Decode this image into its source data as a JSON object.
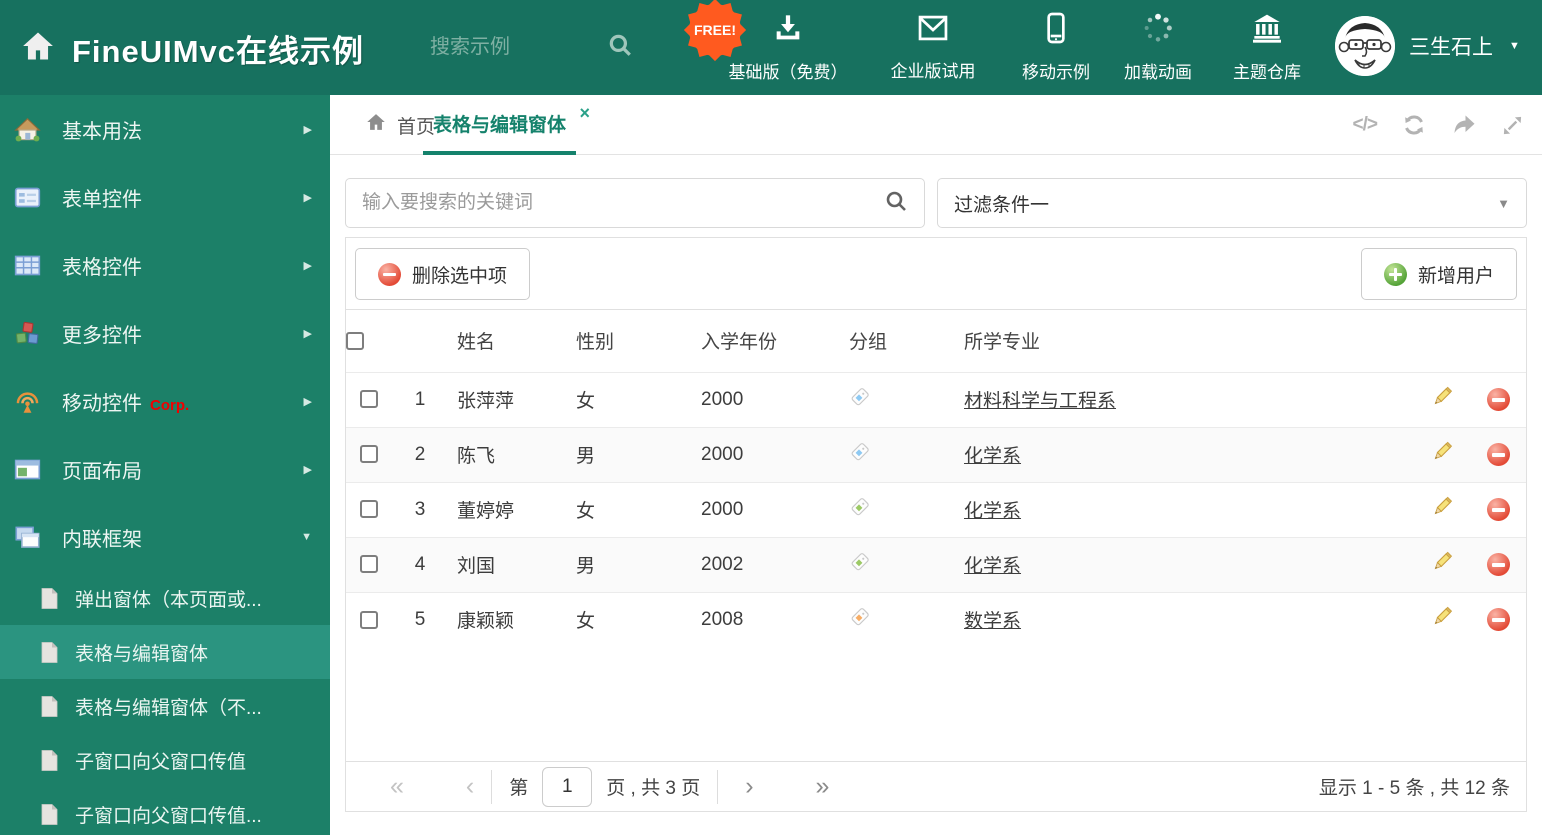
{
  "header": {
    "brand": "FineUIMvc在线示例",
    "search_placeholder": "搜索示例",
    "free_badge": "FREE!",
    "nav_items": [
      {
        "label": "基础版（免费）",
        "icon": "download-icon"
      },
      {
        "label": "企业版试用",
        "icon": "envelope-icon"
      },
      {
        "label": "移动示例",
        "icon": "mobile-icon"
      },
      {
        "label": "加载动画",
        "icon": "spinner-icon"
      },
      {
        "label": "主题仓库",
        "icon": "bank-icon"
      }
    ],
    "user": {
      "name": "三生石上"
    }
  },
  "sidebar": {
    "items": [
      {
        "label": "基本用法",
        "icon": "home-colored-icon",
        "expanded": false
      },
      {
        "label": "表单控件",
        "icon": "form-icon",
        "expanded": false
      },
      {
        "label": "表格控件",
        "icon": "table-icon",
        "expanded": false
      },
      {
        "label": "更多控件",
        "icon": "cubes-icon",
        "expanded": false
      },
      {
        "label": "移动控件",
        "badge": "Corp.",
        "icon": "antenna-icon",
        "expanded": false
      },
      {
        "label": "页面布局",
        "icon": "layout-icon",
        "expanded": false
      },
      {
        "label": "内联框架",
        "icon": "frames-icon",
        "expanded": true
      }
    ],
    "subitems": [
      {
        "label": "弹出窗体（本页面或...",
        "active": false
      },
      {
        "label": "表格与编辑窗体",
        "active": true
      },
      {
        "label": "表格与编辑窗体（不...",
        "active": false
      },
      {
        "label": "子窗口向父窗口传值",
        "active": false
      },
      {
        "label": "子窗口向父窗口传值...",
        "active": false
      }
    ]
  },
  "tabs": [
    {
      "label": "首页",
      "active": false
    },
    {
      "label": "表格与编辑窗体",
      "active": true,
      "closable": true
    }
  ],
  "filters": {
    "search_placeholder": "输入要搜索的关键词",
    "filter_value": "过滤条件一"
  },
  "toolbar": {
    "delete_label": "删除选中项",
    "add_label": "新增用户"
  },
  "table": {
    "columns": [
      "姓名",
      "性别",
      "入学年份",
      "分组",
      "所学专业"
    ],
    "rows": [
      {
        "num": "1",
        "name": "张萍萍",
        "gender": "女",
        "year": "2000",
        "tag_color": "#8ec9f2",
        "major": "材料科学与工程系"
      },
      {
        "num": "2",
        "name": "陈飞",
        "gender": "男",
        "year": "2000",
        "tag_color": "#8ec9f2",
        "major": "化学系"
      },
      {
        "num": "3",
        "name": "董婷婷",
        "gender": "女",
        "year": "2000",
        "tag_color": "#9cc965",
        "major": "化学系"
      },
      {
        "num": "4",
        "name": "刘国",
        "gender": "男",
        "year": "2002",
        "tag_color": "#9cc965",
        "major": "化学系"
      },
      {
        "num": "5",
        "name": "康颖颖",
        "gender": "女",
        "year": "2008",
        "tag_color": "#f6ad66",
        "major": "数学系"
      }
    ]
  },
  "pagination": {
    "prefix": "第",
    "page": "1",
    "suffix": "页 , 共 3 页",
    "summary": "显示 1 - 5 条 , 共 12 条"
  },
  "icons": {
    "caret_right": "▶",
    "caret_down": "▼",
    "user_caret": "▼",
    "filter_caret": "▼",
    "close": "×",
    "code": "</>",
    "first": "«",
    "prev": "‹",
    "next": "›",
    "last": "»"
  },
  "colors": {
    "header_bg": "#17715f",
    "sidebar_bg": "#1c8068",
    "sidebar_active_bg": "#2b9480",
    "accent_teal": "#15826c",
    "free_badge_bg": "#ff5a1f",
    "corp_badge": "#f10000",
    "delete_red": "#e34a36",
    "add_green": "#55a338"
  }
}
